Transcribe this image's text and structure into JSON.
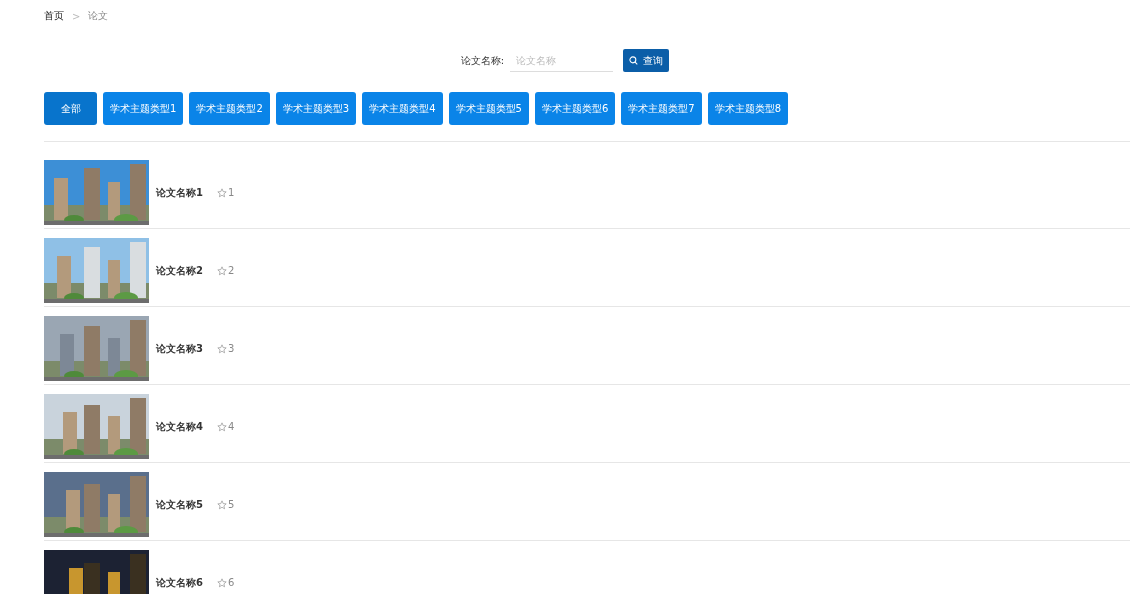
{
  "breadcrumb": [
    {
      "label": "首页",
      "current": false
    },
    {
      "label": "论文",
      "current": true
    }
  ],
  "breadcrumb_separator": ">",
  "search": {
    "label": "论文名称:",
    "placeholder": "论文名称",
    "button": "查询"
  },
  "categories": [
    {
      "label": "全部",
      "selected": true
    },
    {
      "label": "学术主题类型1",
      "selected": false
    },
    {
      "label": "学术主题类型2",
      "selected": false
    },
    {
      "label": "学术主题类型3",
      "selected": false
    },
    {
      "label": "学术主题类型4",
      "selected": false
    },
    {
      "label": "学术主题类型5",
      "selected": false
    },
    {
      "label": "学术主题类型6",
      "selected": false
    },
    {
      "label": "学术主题类型7",
      "selected": false
    },
    {
      "label": "学术主题类型8",
      "selected": false
    }
  ],
  "papers": [
    {
      "title": "论文名称1",
      "count": "1"
    },
    {
      "title": "论文名称2",
      "count": "2"
    },
    {
      "title": "论文名称3",
      "count": "3"
    },
    {
      "title": "论文名称4",
      "count": "4"
    },
    {
      "title": "论文名称5",
      "count": "5"
    },
    {
      "title": "论文名称6",
      "count": "6"
    }
  ]
}
